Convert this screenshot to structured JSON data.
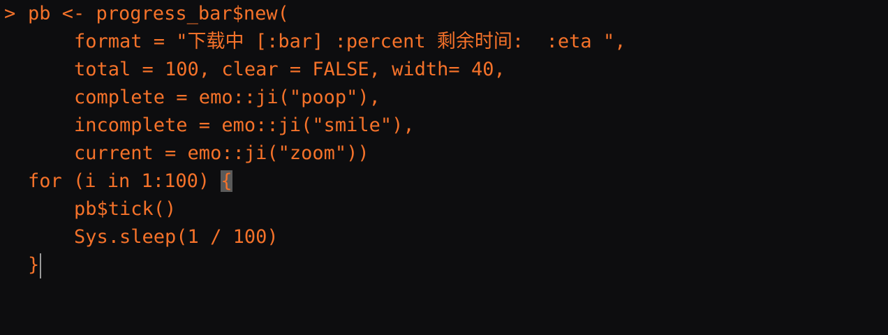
{
  "console": {
    "prompt_symbol": ">",
    "lines": [
      {
        "text": "pb <- progress_bar$new("
      },
      {
        "text": "format = \"下载中 [:bar] :percent 剩余时间:  :eta \","
      },
      {
        "text": "total = 100, clear = FALSE, width= 40,"
      },
      {
        "text": "complete = emo::ji(\"poop\"),"
      },
      {
        "text": "incomplete = emo::ji(\"smile\"),"
      },
      {
        "text": "current = emo::ji(\"zoom\"))"
      },
      {
        "text_before": "for (i in 1:100) ",
        "brace": "{"
      },
      {
        "text": "pb$tick()"
      },
      {
        "text": "Sys.sleep(1 / 100)"
      },
      {
        "text": "}"
      }
    ]
  },
  "colors": {
    "background": "#0d0d0f",
    "text": "#f5722a",
    "brace_highlight": "#5a5a5a",
    "cursor": "#9a9a9a"
  }
}
